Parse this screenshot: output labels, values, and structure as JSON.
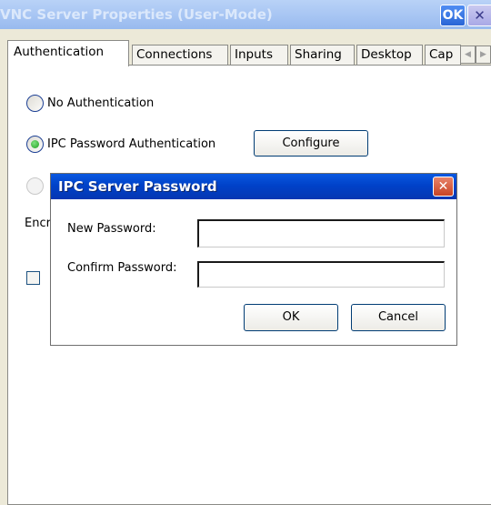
{
  "window": {
    "title": "VNC Server Properties (User-Mode)",
    "ok_label": "OK",
    "close_label": "✕"
  },
  "tabs": [
    {
      "label": "Authentication",
      "active": true
    },
    {
      "label": "Connections"
    },
    {
      "label": "Inputs"
    },
    {
      "label": "Sharing"
    },
    {
      "label": "Desktop"
    },
    {
      "label": "Cap"
    }
  ],
  "tab_scroll": {
    "left": "◀",
    "right": "▶"
  },
  "auth": {
    "option_none": "No Authentication",
    "option_ipc": "IPC Password Authentication",
    "configure_label": "Configure",
    "encryption_label_partial": "Encr"
  },
  "dialog": {
    "title": "IPC Server Password",
    "close_label": "✕",
    "new_password_label": "New Password:",
    "confirm_password_label": "Confirm Password:",
    "new_password_value": "",
    "confirm_password_value": "",
    "ok_label": "OK",
    "cancel_label": "Cancel"
  },
  "colors": {
    "titlebar_inactive": "#a7c5f3",
    "dialog_title": "#0042c9",
    "dialog_close": "#c84324",
    "window_bg": "#ece9d8"
  }
}
